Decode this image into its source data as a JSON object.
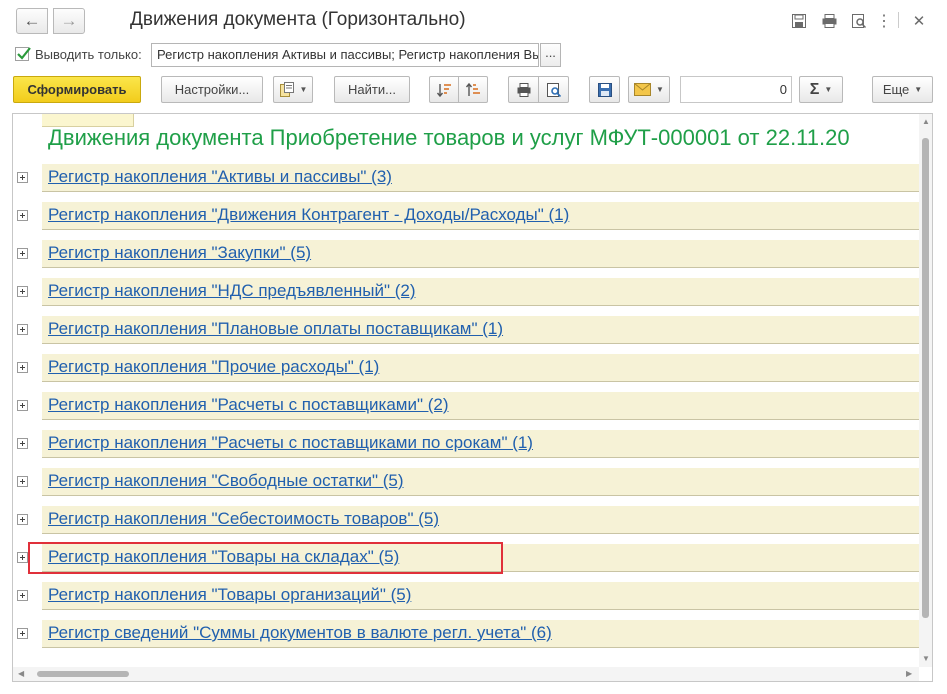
{
  "window": {
    "title": "Движения документа (Горизонтально)",
    "icons": [
      "save-icon",
      "print-icon",
      "preview-icon",
      "more-vertical-icon",
      "close-icon"
    ]
  },
  "filter": {
    "checked": true,
    "label": "Выводить только:",
    "value": "Регистр накопления Активы и пассивы; Регистр накопления Вы",
    "more_label": "..."
  },
  "toolbar": {
    "generate_label": "Сформировать",
    "settings_label": "Настройки...",
    "find_label": "Найти...",
    "number_value": "0",
    "sum_label": "Σ",
    "more_label": "Еще"
  },
  "report": {
    "title": "Движения документа Приобретение товаров и услуг МФУТ-000001 от 22.11.20",
    "registers": [
      "Регистр накопления \"Активы и пассивы\" (3)",
      "Регистр накопления \"Движения Контрагент - Доходы/Расходы\" (1)",
      "Регистр накопления \"Закупки\" (5)",
      "Регистр накопления \"НДС предъявленный\" (2)",
      "Регистр накопления \"Плановые оплаты поставщикам\" (1)",
      "Регистр накопления \"Прочие расходы\" (1)",
      "Регистр накопления \"Расчеты с поставщиками\" (2)",
      "Регистр накопления \"Расчеты с поставщиками по срокам\" (1)",
      "Регистр накопления \"Свободные остатки\" (5)",
      "Регистр накопления \"Себестоимость товаров\" (5)",
      "Регистр накопления \"Товары на складах\" (5)",
      "Регистр накопления \"Товары организаций\" (5)",
      "Регистр сведений \"Суммы документов в валюте регл. учета\" (6)"
    ]
  }
}
